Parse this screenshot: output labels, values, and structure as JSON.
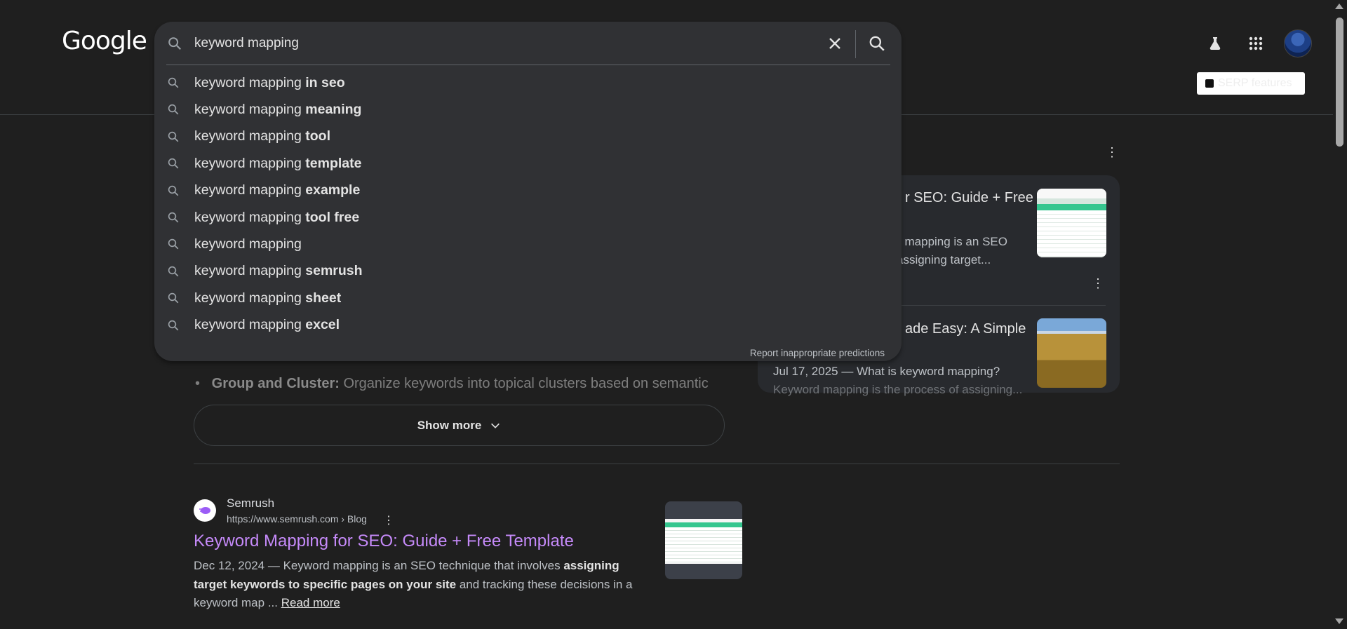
{
  "header": {
    "logo": "Google",
    "serp_button_label": "SERP features"
  },
  "search": {
    "query": "keyword mapping",
    "suggestions": [
      {
        "base": "keyword mapping",
        "bold": "in seo"
      },
      {
        "base": "keyword mapping",
        "bold": "meaning"
      },
      {
        "base": "keyword mapping",
        "bold": "tool"
      },
      {
        "base": "keyword mapping",
        "bold": "template"
      },
      {
        "base": "keyword mapping",
        "bold": "example"
      },
      {
        "base": "keyword mapping",
        "bold": "tool free"
      },
      {
        "base": "keyword mapping",
        "bold": ""
      },
      {
        "base": "keyword mapping",
        "bold": "semrush"
      },
      {
        "base": "keyword mapping",
        "bold": "sheet"
      },
      {
        "base": "keyword mapping",
        "bold": "excel"
      }
    ],
    "report_text": "Report inappropriate predictions"
  },
  "side_panel": {
    "card1_title_a": "r SEO: Guide + Free",
    "card1_snippet_a": "l mapping is an SEO",
    "card1_snippet_b": "assigning target...",
    "card2_title": "ade Easy: A Simple",
    "card2_date": "Jul 17, 2025 — What is keyword mapping?",
    "card2_snippet": "Keyword mapping is the process of assigning..."
  },
  "main": {
    "bullet_bold": "Group and Cluster:",
    "bullet_text": " Organize keywords into topical clusters based on semantic",
    "show_more": "Show more",
    "result": {
      "site_name": "Semrush",
      "url": "https://www.semrush.com › Blog",
      "title": "Keyword Mapping for SEO: Guide + Free Template",
      "date": "Dec 12, 2024",
      "snip1": " — Keyword mapping is an SEO technique that involves ",
      "snip_bold": "assigning target keywords to specific pages on your site",
      "snip2": " and tracking these decisions in a keyword map ... ",
      "read_more": "Read more"
    }
  }
}
